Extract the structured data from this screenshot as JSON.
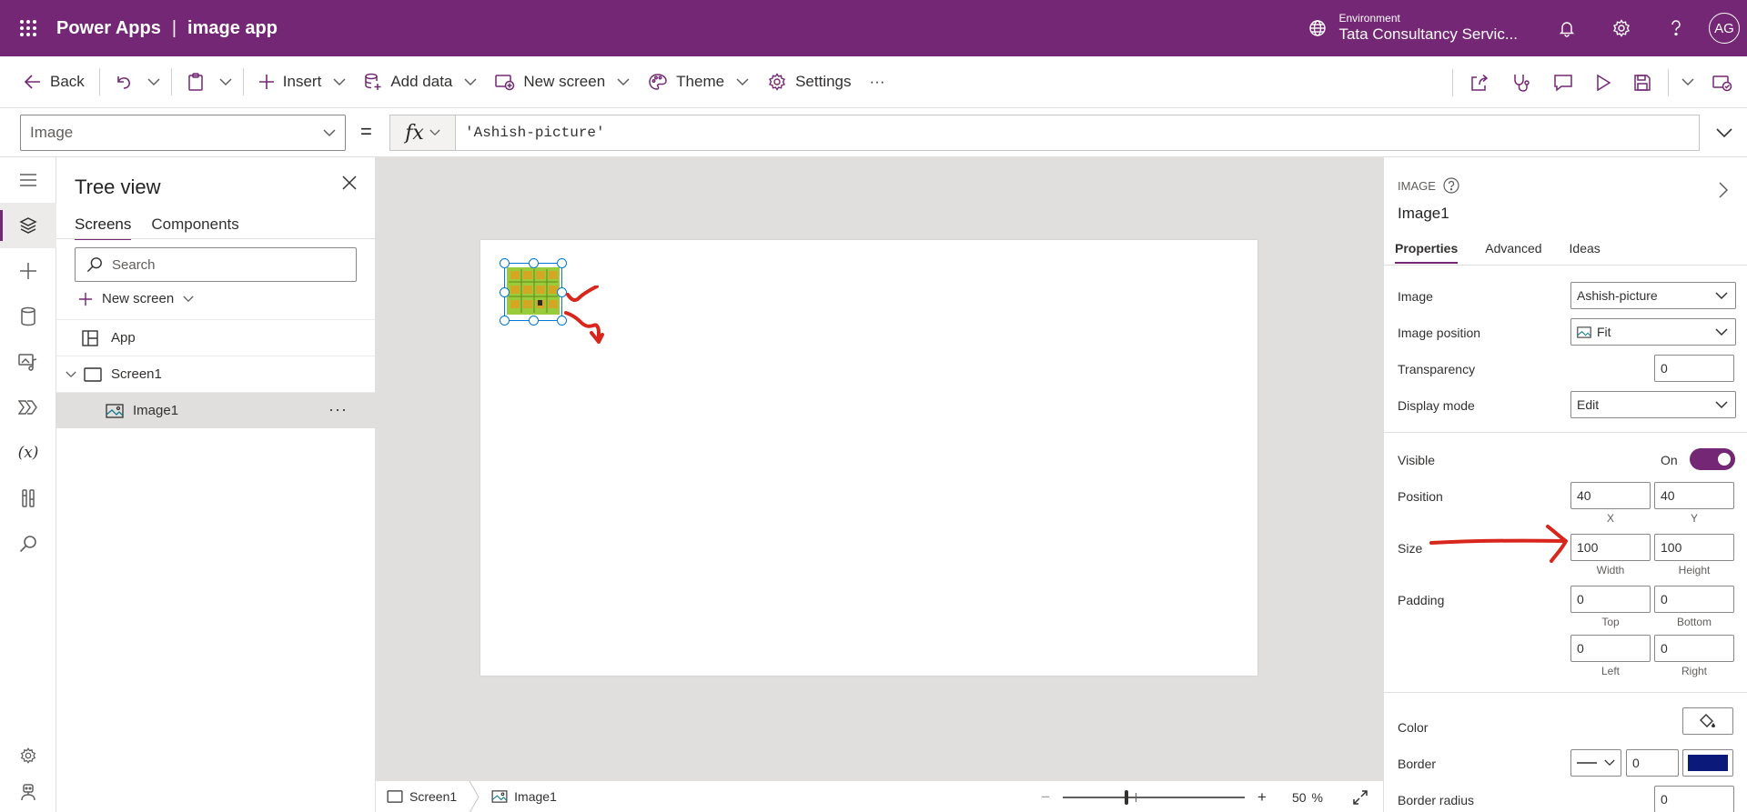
{
  "header": {
    "product": "Power Apps",
    "separator": "|",
    "app_name": "image app",
    "environment_label": "Environment",
    "environment_name": "Tata Consultancy Servic...",
    "user_initials": "AG"
  },
  "commandbar": {
    "back": "Back",
    "insert": "Insert",
    "add_data": "Add data",
    "new_screen": "New screen",
    "theme": "Theme",
    "settings": "Settings",
    "more": "···"
  },
  "formula": {
    "property": "Image",
    "equals": "=",
    "fx": "fx",
    "expression": "'Ashish-picture'"
  },
  "tree": {
    "title": "Tree view",
    "tabs": [
      "Screens",
      "Components"
    ],
    "search_placeholder": "Search",
    "new_screen": "New screen",
    "items": [
      "App",
      "Screen1",
      "Image1"
    ],
    "more": "···"
  },
  "statusbar": {
    "crumbs": [
      "Screen1",
      "Image1"
    ],
    "zoom_minus": "−",
    "zoom_plus": "+",
    "zoom_value": "50",
    "zoom_unit": "%",
    "zoom_fraction": 0.5
  },
  "properties": {
    "kind": "IMAGE",
    "name": "Image1",
    "tabs": [
      "Properties",
      "Advanced",
      "Ideas"
    ],
    "image_label": "Image",
    "image_value": "Ashish-picture",
    "image_position_label": "Image position",
    "image_position_value": "Fit",
    "transparency_label": "Transparency",
    "transparency_value": "0",
    "display_mode_label": "Display mode",
    "display_mode_value": "Edit",
    "visible_label": "Visible",
    "visible_state": "On",
    "position_label": "Position",
    "position_x": "40",
    "position_y": "40",
    "x_caption": "X",
    "y_caption": "Y",
    "size_label": "Size",
    "width": "100",
    "height": "100",
    "width_caption": "Width",
    "height_caption": "Height",
    "padding_label": "Padding",
    "padding_top": "0",
    "padding_bottom": "0",
    "padding_left": "0",
    "padding_right": "0",
    "top_caption": "Top",
    "bottom_caption": "Bottom",
    "left_caption": "Left",
    "right_caption": "Right",
    "color_label": "Color",
    "border_label": "Border",
    "border_width": "0",
    "border_color": "#0b1a7a",
    "border_radius_label": "Border radius",
    "border_radius_value": "0"
  },
  "colors": {
    "brand": "#742774",
    "selection": "#0078d4",
    "annotation": "#d9261c"
  }
}
